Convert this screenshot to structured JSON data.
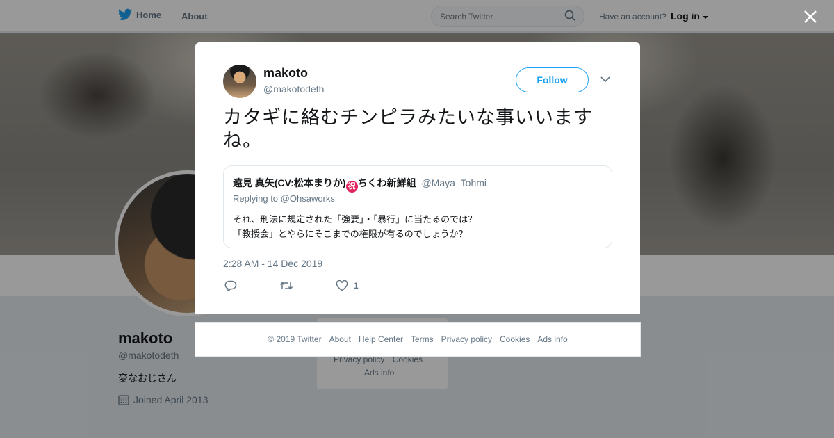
{
  "topnav": {
    "home": "Home",
    "about": "About",
    "search_placeholder": "Search Twitter",
    "account_prompt": "Have an account?",
    "login": "Log in"
  },
  "profile": {
    "name": "makoto",
    "handle": "@makotodeth",
    "bio": "変なおじさん",
    "joined": "Joined April 2013",
    "side_links": [
      "Privacy policy",
      "Cookies"
    ],
    "side_ads": "Ads info"
  },
  "tweet": {
    "display_name": "makoto",
    "username": "@makotodeth",
    "follow_label": "Follow",
    "text": "カタギに絡むチンピラみたいな事いいますね。",
    "timestamp": "2:28 AM - 14 Dec 2019",
    "like_count": "1",
    "quoted": {
      "name_part1": "遠見 真矢(CV:松本まりか)",
      "badge": "祝",
      "name_part2": "ちくわ新鮮組",
      "handle": "@Maya_Tohmi",
      "replying_prefix": "Replying to",
      "replying_to": "@Ohsaworks",
      "line1": "それ、刑法に規定された「強要」・「暴行」に当たるのでは？",
      "line2": "「教授会」とやらにそこまでの権限が有るのでしょうか？"
    }
  },
  "footer": {
    "copyright": "© 2019 Twitter",
    "about": "About",
    "help": "Help Center",
    "terms": "Terms",
    "privacy": "Privacy policy",
    "cookies": "Cookies",
    "ads": "Ads info"
  },
  "colors": {
    "brand_blue": "#1da1f2",
    "text_primary": "#14171a",
    "text_secondary": "#657786",
    "border": "#e1e8ed"
  },
  "icons": [
    "twitter-bird-icon",
    "search-icon",
    "caret-down-icon",
    "close-icon",
    "calendar-icon",
    "chevron-down-icon",
    "reply-icon",
    "retweet-icon",
    "heart-icon"
  ]
}
